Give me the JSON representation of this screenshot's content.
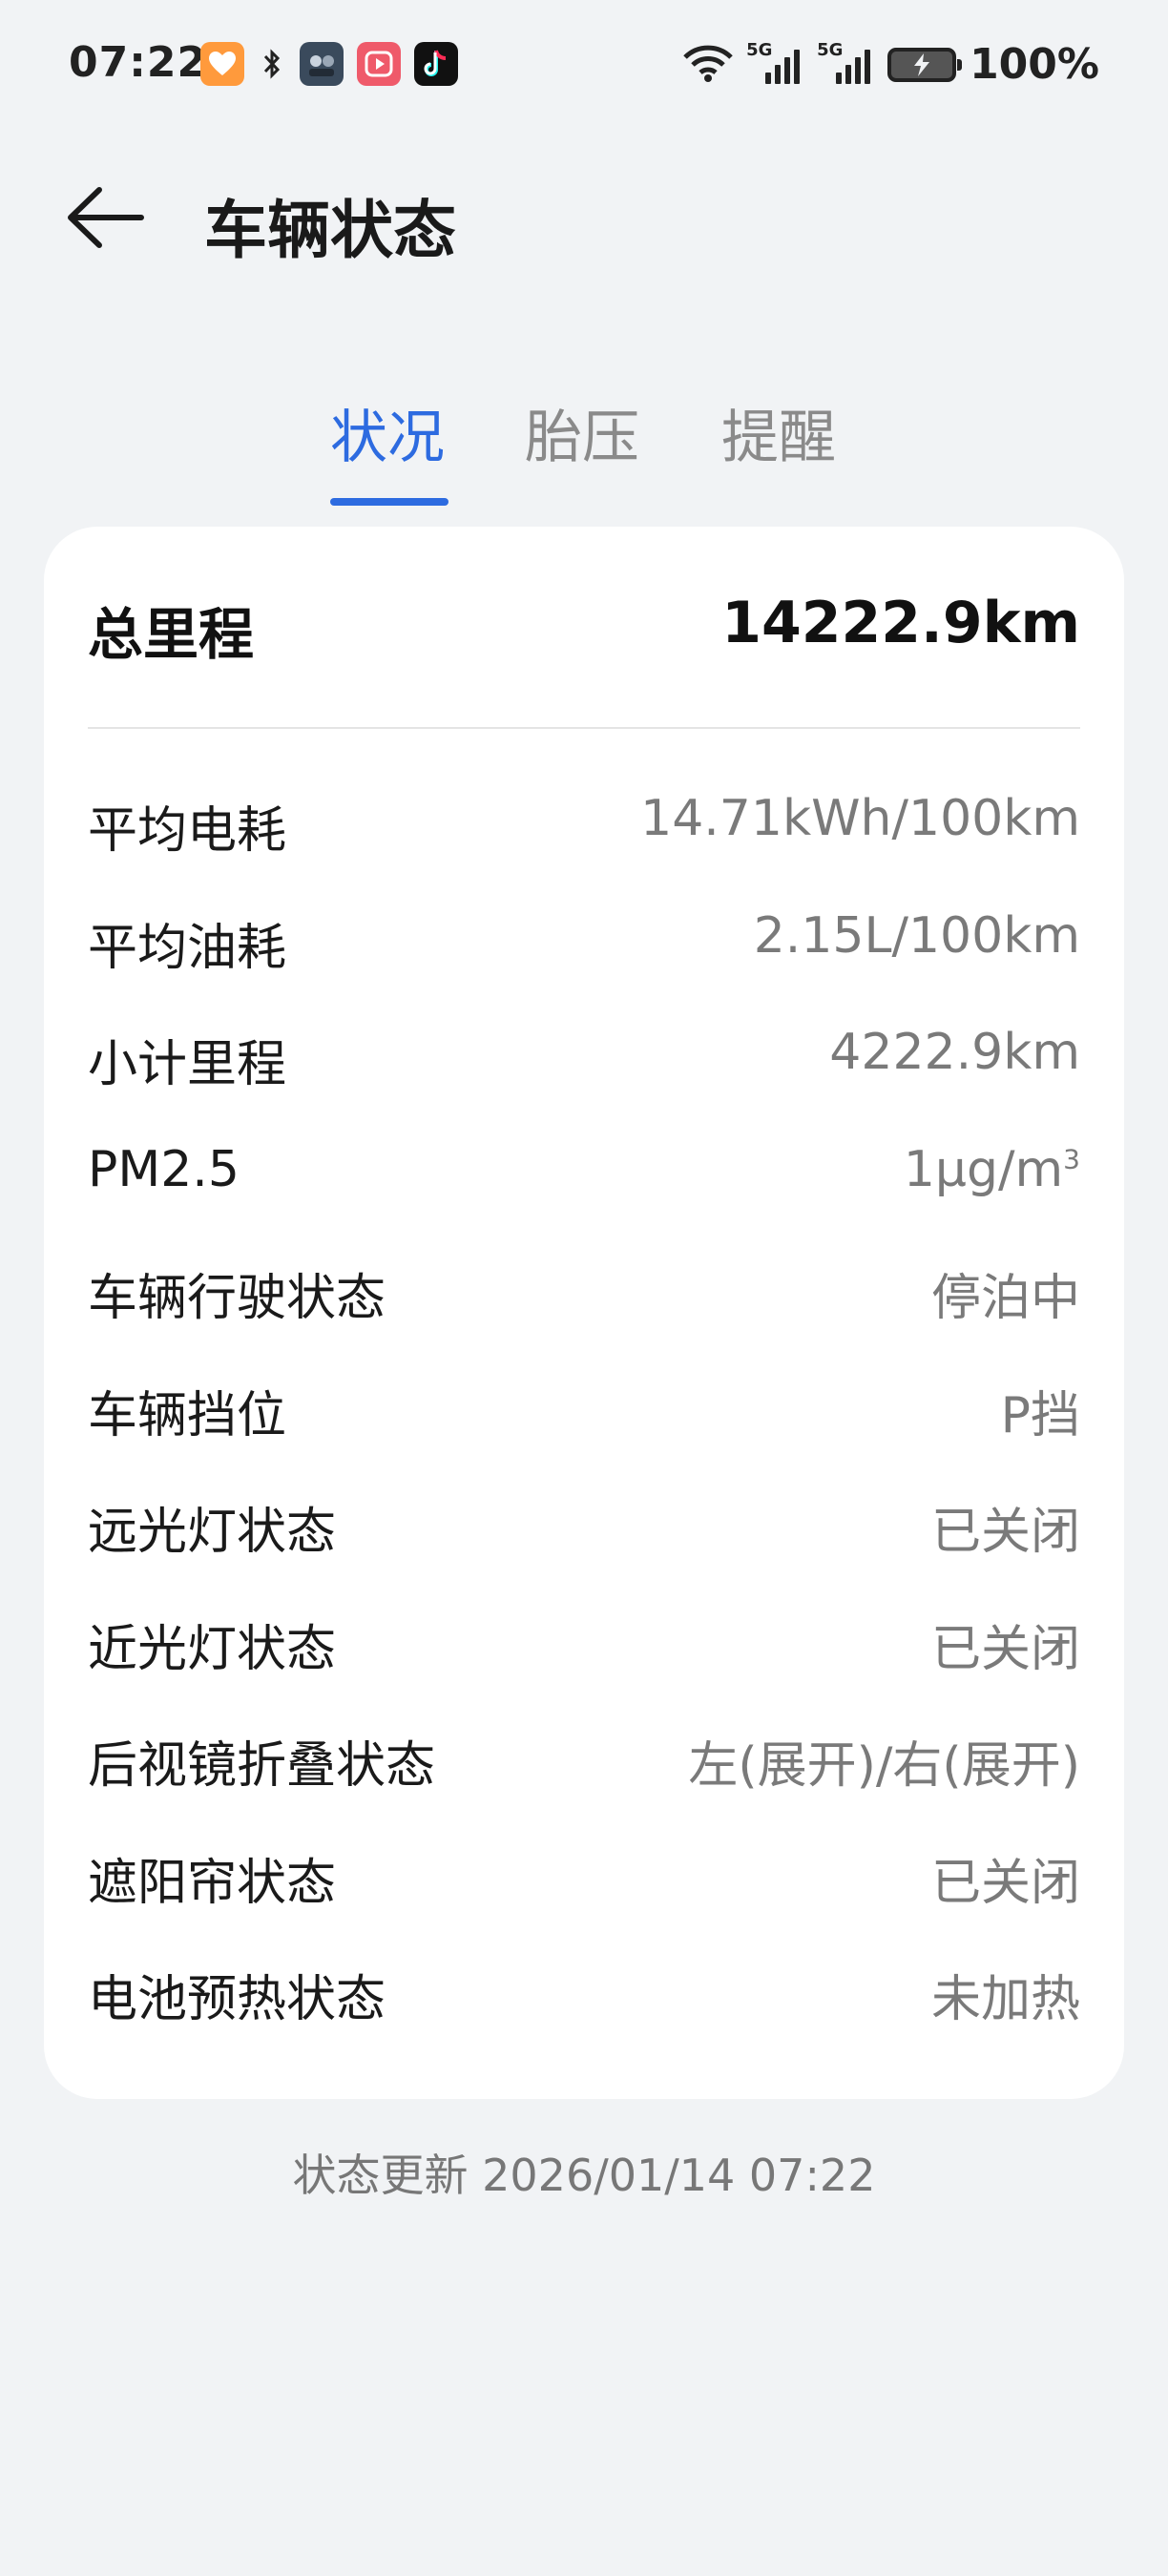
{
  "status_bar": {
    "time": "07:22",
    "battery_percent": "100%",
    "network_1": "5G",
    "network_2": "5G",
    "app_icons": [
      "heart-app-icon",
      "bluetooth-icon",
      "photo-app-icon",
      "video-app-icon",
      "tiktok-icon"
    ]
  },
  "header": {
    "title": "车辆状态",
    "back_icon": "arrow-left-icon"
  },
  "tabs": [
    {
      "label": "状况",
      "active": true
    },
    {
      "label": "胎压",
      "active": false
    },
    {
      "label": "提醒",
      "active": false
    }
  ],
  "summary": {
    "label": "总里程",
    "value": "14222.9km"
  },
  "rows": [
    {
      "label": "平均电耗",
      "value": "14.71kWh/100km"
    },
    {
      "label": "平均油耗",
      "value": "2.15L/100km"
    },
    {
      "label": "小计里程",
      "value": "4222.9km"
    },
    {
      "label": "PM2.5",
      "value": "1μg/m",
      "sup": "3"
    },
    {
      "label": "车辆行驶状态",
      "value": "停泊中"
    },
    {
      "label": "车辆挡位",
      "value": "P挡"
    },
    {
      "label": "远光灯状态",
      "value": "已关闭"
    },
    {
      "label": "近光灯状态",
      "value": "已关闭"
    },
    {
      "label": "后视镜折叠状态",
      "value": "左(展开)/右(展开)"
    },
    {
      "label": "遮阳帘状态",
      "value": "已关闭"
    },
    {
      "label": "电池预热状态",
      "value": "未加热"
    }
  ],
  "footer": {
    "update_text": "状态更新 2026/01/14 07:22"
  },
  "colors": {
    "accent": "#2d6be0",
    "background": "#f1f3f5",
    "card": "#ffffff",
    "value_text": "#7a7a7a"
  }
}
